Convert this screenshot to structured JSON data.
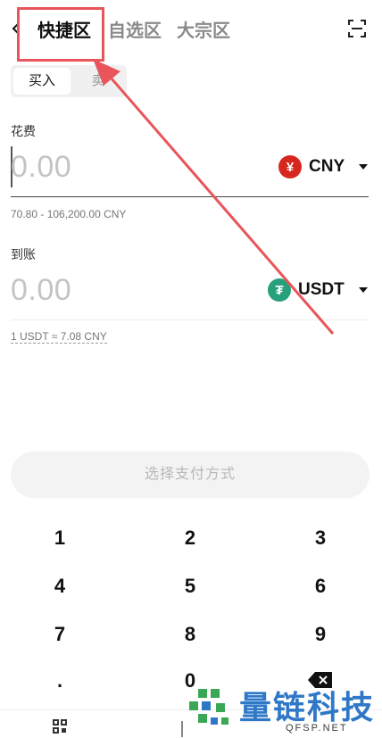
{
  "nav": {
    "tabs": [
      {
        "label": "快捷区",
        "active": true
      },
      {
        "label": "自选区",
        "active": false
      },
      {
        "label": "大宗区",
        "active": false
      }
    ]
  },
  "trade_mode": {
    "buy": "买入",
    "sell": "卖"
  },
  "spend": {
    "label": "花费",
    "placeholder": "0.00",
    "currency": "CNY",
    "currency_symbol": "¥",
    "range": "70.80 - 106,200.00 CNY"
  },
  "receive": {
    "label": "到账",
    "placeholder": "0.00",
    "currency": "USDT",
    "currency_symbol": "₮",
    "rate": "1 USDT ≈ 7.08 CNY"
  },
  "pay_button": "选择支付方式",
  "keypad": {
    "row1": [
      "1",
      "2",
      "3"
    ],
    "row2": [
      "4",
      "5",
      "6"
    ],
    "row3": [
      "7",
      "8",
      "9"
    ],
    "row4": [
      ".",
      "0"
    ]
  },
  "watermark": {
    "text": "量链科技",
    "sub": "QFSP.NET"
  },
  "colors": {
    "highlight": "#e8555a",
    "cny": "#d7261d",
    "usdt": "#26a17b",
    "watermark": "#2e78c7"
  },
  "icons": {
    "back": "chevron-left-icon",
    "scan": "scan-icon",
    "delete": "backspace-icon"
  }
}
